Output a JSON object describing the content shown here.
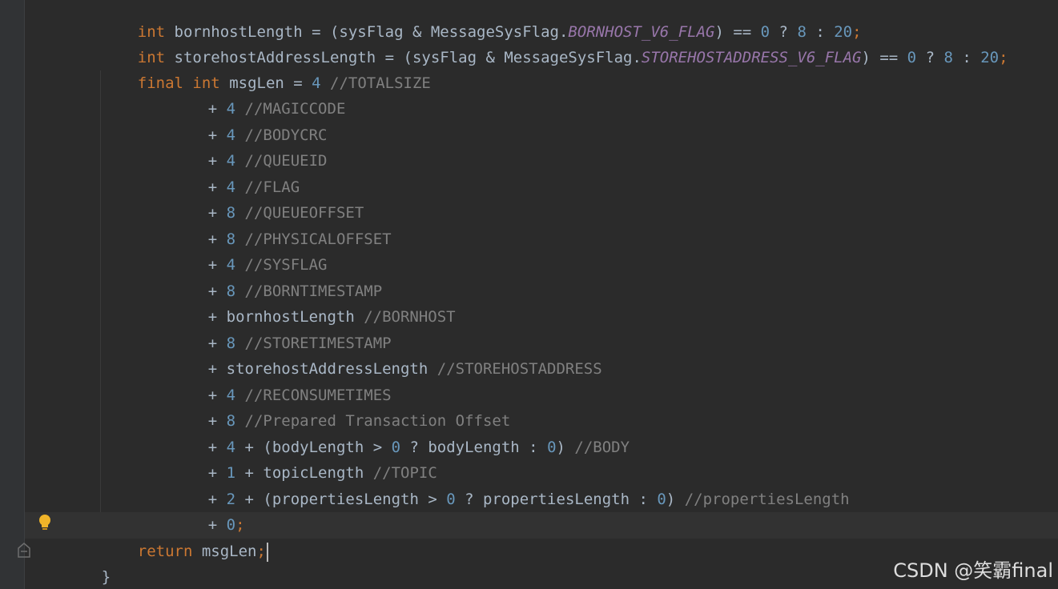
{
  "code": {
    "line1": {
      "kw": "int",
      "a": " bornhostLength = (sysFlag & MessageSysFlag.",
      "const": "BORNHOST_V6_FLAG",
      "b": ") == ",
      "n1": "0",
      "c": " ? ",
      "n2": "8",
      "d": " : ",
      "n3": "20",
      "semi": ";"
    },
    "line2": {
      "kw": "int",
      "a": " storehostAddressLength = (sysFlag & MessageSysFlag.",
      "const": "STOREHOSTADDRESS_V6_FLAG",
      "b": ") == ",
      "n1": "0",
      "c": " ? ",
      "n2": "8",
      "d": " : ",
      "n3": "20",
      "semi": ";"
    },
    "line3": {
      "kw1": "final",
      "kw2": "int",
      "a": " msgLen = ",
      "n": "4",
      "cm": " //TOTALSIZE"
    },
    "terms": [
      {
        "prefix": "+ ",
        "num": "4",
        "comment": " //MAGICCODE"
      },
      {
        "prefix": "+ ",
        "num": "4",
        "comment": " //BODYCRC"
      },
      {
        "prefix": "+ ",
        "num": "4",
        "comment": " //QUEUEID"
      },
      {
        "prefix": "+ ",
        "num": "4",
        "comment": " //FLAG"
      },
      {
        "prefix": "+ ",
        "num": "8",
        "comment": " //QUEUEOFFSET"
      },
      {
        "prefix": "+ ",
        "num": "8",
        "comment": " //PHYSICALOFFSET"
      },
      {
        "prefix": "+ ",
        "num": "4",
        "comment": " //SYSFLAG"
      },
      {
        "prefix": "+ ",
        "num": "8",
        "comment": " //BORNTIMESTAMP"
      }
    ],
    "term_bornhost": {
      "a": "+ bornhostLength",
      "cm": " //BORNHOST"
    },
    "term_storets": {
      "prefix": "+ ",
      "num": "8",
      "comment": " //STORETIMESTAMP"
    },
    "term_storehost": {
      "a": "+ storehostAddressLength",
      "cm": " //STOREHOSTADDRESS"
    },
    "term_reconsume": {
      "prefix": "+ ",
      "num": "4",
      "comment": " //RECONSUMETIMES"
    },
    "term_prepared": {
      "prefix": "+ ",
      "num": "8",
      "comment": " //Prepared Transaction Offset"
    },
    "term_body": {
      "p": "+ ",
      "n1": "4",
      "a": " + (bodyLength > ",
      "n2": "0",
      "b": " ? bodyLength : ",
      "n3": "0",
      "c": ")",
      "cm": " //BODY"
    },
    "term_topic": {
      "p": "+ ",
      "n": "1",
      "a": " + topicLength",
      "cm": " //TOPIC"
    },
    "term_props": {
      "p": "+ ",
      "n1": "2",
      "a": " + (propertiesLength > ",
      "n2": "0",
      "b": " ? propertiesLength : ",
      "n3": "0",
      "c": ")",
      "cm": " //propertiesLength"
    },
    "term_zero": {
      "p": "+ ",
      "n": "0",
      "semi": ";"
    },
    "return_line": {
      "kw": "return",
      "a": " msgLen",
      "semi": ";"
    },
    "close_brace": "}"
  },
  "watermark": "CSDN @笑霸final",
  "icons": {
    "intention": "lightbulb-icon",
    "fold": "fold-marker-icon"
  },
  "colors": {
    "background": "#2b2b2b",
    "keyword": "#cc7832",
    "number": "#6897bb",
    "comment": "#808080",
    "constant": "#9876aa",
    "text": "#a9b7c6"
  }
}
